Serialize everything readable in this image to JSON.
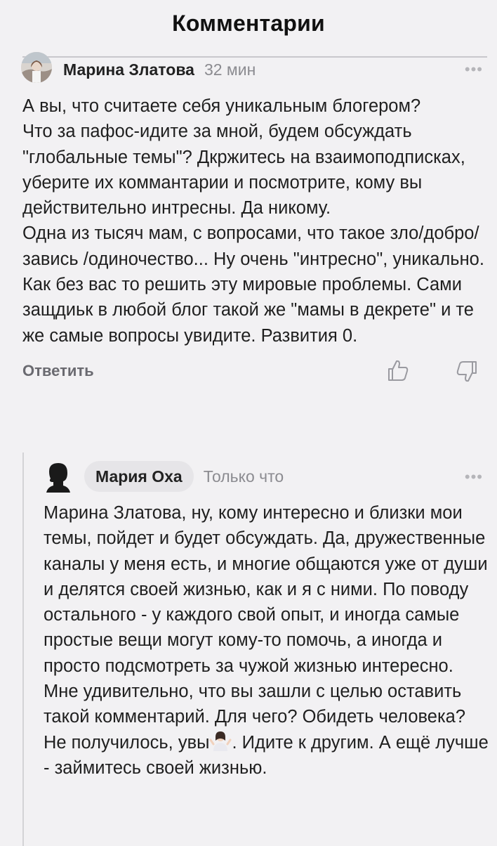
{
  "header": {
    "title": "Комментарии"
  },
  "comments": [
    {
      "author": "Марина Златова",
      "time": "32 мин",
      "more": "•••",
      "text": "А вы, что считаете себя уникальным блогером?\nЧто за пафос-идите за мной, будем обсуждать \"глобальные темы\"? Дкржитесь на взаимоподписках, уберите их коммантарии и посмотрите, кому вы действительно интресны. Да никому.\nОдна из тысяч мам, с вопросами, что такое зло/добро/завись /одиночество... Ну очень \"интресно\",  уникально. Как без вас то решить эту мировые проблемы. Сами защдиьк в любой блог такой же \"мамы в декрете\" и те же самые вопросы увидите. Развития 0.",
      "reply_label": "Ответить",
      "like_icon": "thumbs-up-icon",
      "dislike_icon": "thumbs-down-icon"
    },
    {
      "author": "Мария Оха",
      "time": "Только что",
      "more": "•••",
      "text_before_emoji": "Марина Златова, ну, кому интересно и близки мои темы, пойдет и будет обсуждать. Да, дружественные каналы у меня есть, и многие общаются уже от души и делятся своей жизнью, как и я с ними. По поводу остального - у каждого свой опыт, и иногда самые простые вещи могут кому-то помочь, а иногда и просто подсмотреть за чужой жизнью интересно. Мне удивительно, что вы зашли с целью оставить такой комментарий. Для чего? Обидеть человека? Не получилось, увы",
      "emoji_icon": "shrugging-woman-emoji",
      "text_after_emoji": ". Идите к другим. А ещё лучше - займитесь своей жизнью."
    }
  ],
  "colors": {
    "background": "#f2f1f3",
    "muted_text": "#8b8b90",
    "chip": "#e6e5e8"
  }
}
